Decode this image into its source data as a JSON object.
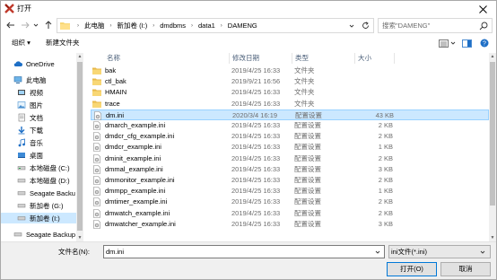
{
  "window": {
    "title": "打开"
  },
  "nav": {
    "breadcrumbs": [
      "此电脑",
      "新加卷 (I:)",
      "dmdbms",
      "data1",
      "DAMENG"
    ],
    "search_placeholder": "搜索\"DAMENG\""
  },
  "toolbar": {
    "organize": "组织 ▾",
    "new_folder": "新建文件夹"
  },
  "sidebar": {
    "items": [
      {
        "label": "OneDrive",
        "icon": "cloud-icon"
      },
      {
        "label": "此电脑",
        "icon": "computer-icon"
      },
      {
        "label": "视频",
        "icon": "video-folder-icon"
      },
      {
        "label": "图片",
        "icon": "pictures-folder-icon"
      },
      {
        "label": "文档",
        "icon": "documents-folder-icon"
      },
      {
        "label": "下载",
        "icon": "download-icon"
      },
      {
        "label": "音乐",
        "icon": "music-icon"
      },
      {
        "label": "桌面",
        "icon": "desktop-folder-icon"
      },
      {
        "label": "本地磁盘 (C:)",
        "icon": "drive-icon"
      },
      {
        "label": "本地磁盘 (D:)",
        "icon": "drive-icon"
      },
      {
        "label": "Seagate Backu",
        "icon": "drive-icon"
      },
      {
        "label": "新加卷 (G:)",
        "icon": "drive-icon"
      },
      {
        "label": "新加卷 (I:)",
        "icon": "drive-icon"
      },
      {
        "label": "Seagate Backup",
        "icon": "drive-icon"
      }
    ]
  },
  "columns": {
    "name": "名称",
    "date": "修改日期",
    "type": "类型",
    "size": "大小"
  },
  "files": [
    {
      "name": "bak",
      "date": "2019/4/25 16:33",
      "type": "文件夹",
      "size": "",
      "kind": "folder"
    },
    {
      "name": "ctl_bak",
      "date": "2019/9/21 16:56",
      "type": "文件夹",
      "size": "",
      "kind": "folder"
    },
    {
      "name": "HMAIN",
      "date": "2019/4/25 16:33",
      "type": "文件夹",
      "size": "",
      "kind": "folder"
    },
    {
      "name": "trace",
      "date": "2019/4/25 16:33",
      "type": "文件夹",
      "size": "",
      "kind": "folder"
    },
    {
      "name": "dm.ini",
      "date": "2020/3/4 16:19",
      "type": "配置设置",
      "size": "43 KB",
      "kind": "ini"
    },
    {
      "name": "dmarch_example.ini",
      "date": "2019/4/25 16:33",
      "type": "配置设置",
      "size": "2 KB",
      "kind": "ini"
    },
    {
      "name": "dmdcr_cfg_example.ini",
      "date": "2019/4/25 16:33",
      "type": "配置设置",
      "size": "2 KB",
      "kind": "ini"
    },
    {
      "name": "dmdcr_example.ini",
      "date": "2019/4/25 16:33",
      "type": "配置设置",
      "size": "1 KB",
      "kind": "ini"
    },
    {
      "name": "dminit_example.ini",
      "date": "2019/4/25 16:33",
      "type": "配置设置",
      "size": "2 KB",
      "kind": "ini"
    },
    {
      "name": "dmmal_example.ini",
      "date": "2019/4/25 16:33",
      "type": "配置设置",
      "size": "3 KB",
      "kind": "ini"
    },
    {
      "name": "dmmonitor_example.ini",
      "date": "2019/4/25 16:33",
      "type": "配置设置",
      "size": "2 KB",
      "kind": "ini"
    },
    {
      "name": "dmmpp_example.ini",
      "date": "2019/4/25 16:33",
      "type": "配置设置",
      "size": "1 KB",
      "kind": "ini"
    },
    {
      "name": "dmtimer_example.ini",
      "date": "2019/4/25 16:33",
      "type": "配置设置",
      "size": "2 KB",
      "kind": "ini"
    },
    {
      "name": "dmwatch_example.ini",
      "date": "2019/4/25 16:33",
      "type": "配置设置",
      "size": "2 KB",
      "kind": "ini"
    },
    {
      "name": "dmwatcher_example.ini",
      "date": "2019/4/25 16:33",
      "type": "配置设置",
      "size": "3 KB",
      "kind": "ini"
    }
  ],
  "bottom": {
    "filename_label": "文件名(N):",
    "filename_value": "dm.ini",
    "filetype": "ini文件(*.ini)",
    "open_label": "打开(O)",
    "cancel_label": "取消"
  },
  "colors": {
    "accent": "#0078d7",
    "selection": "#cce8ff",
    "folder": "#f8d775",
    "header_text": "#4c607a"
  }
}
